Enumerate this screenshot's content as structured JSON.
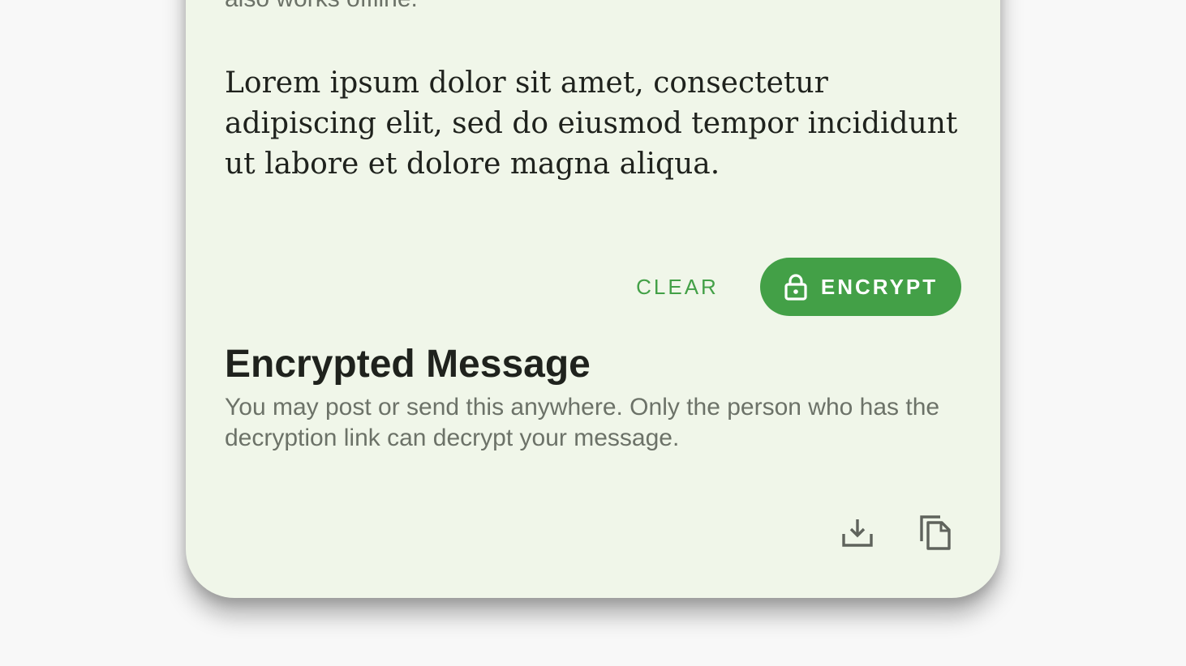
{
  "intro": {
    "text": "also works offline."
  },
  "message": {
    "value": "Lorem ipsum dolor sit amet, consectetur adipiscing elit, sed do eiusmod tempor incididunt ut labore et dolore magna aliqua."
  },
  "actions": {
    "clear_label": "CLEAR",
    "encrypt_label": "ENCRYPT",
    "encrypt_icon": "lock-icon"
  },
  "encrypted": {
    "title": "Encrypted Message",
    "description": "You may post or send this anywhere. Only the person who has the decryption link can decrypt your message.",
    "download_icon": "download-icon",
    "copy_icon": "copy-icon"
  },
  "colors": {
    "accent": "#43a047",
    "card_background": "#f0f6e9",
    "page_background": "#f8f8f8",
    "secondary_text": "#6c7268",
    "primary_text": "#1f221d"
  }
}
